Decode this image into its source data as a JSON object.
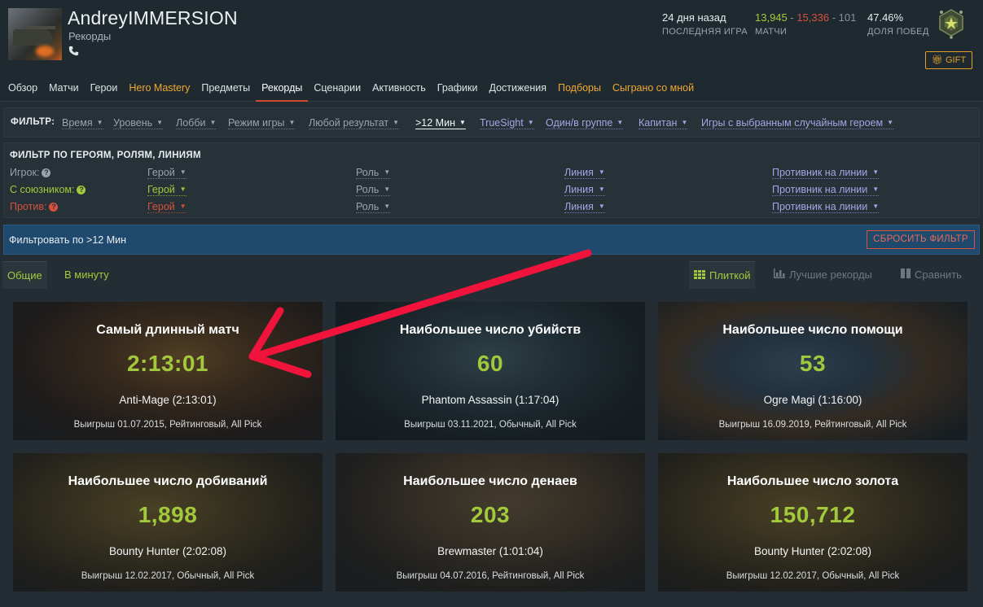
{
  "profile": {
    "name": "AndreyIMMERSION",
    "section": "Рекорды",
    "phone_icon": "phone-icon"
  },
  "stats": {
    "last_game_value": "24 дня назад",
    "last_game_label": "ПОСЛЕДНЯЯ ИГРА",
    "wins": "13,945",
    "losses": "15,336",
    "abandons": "101",
    "matches_label": "МАТЧИ",
    "winrate_value": "47.46%",
    "winrate_label": "ДОЛЯ ПОБЕД",
    "gift_label": "GIFT"
  },
  "tabs": [
    {
      "label": "Обзор"
    },
    {
      "label": "Матчи"
    },
    {
      "label": "Герои"
    },
    {
      "label": "Hero Mastery"
    },
    {
      "label": "Предметы"
    },
    {
      "label": "Рекорды"
    },
    {
      "label": "Сценарии"
    },
    {
      "label": "Активность"
    },
    {
      "label": "Графики"
    },
    {
      "label": "Достижения"
    },
    {
      "label": "Подборы"
    },
    {
      "label": "Сыграно со мной"
    }
  ],
  "filter": {
    "label": "ФИЛЬТР:",
    "items": [
      "Время",
      "Уровень",
      "Лобби",
      "Режим игры",
      "Любой результат",
      ">12 Мин",
      "TrueSight",
      "Один/в группе",
      "Капитан",
      "Игры с выбранным случайным героем"
    ]
  },
  "hero_filter": {
    "title": "ФИЛЬТР ПО ГЕРОЯМ, РОЛЯМ, ЛИНИЯМ",
    "rows": [
      {
        "label": "Игрок:",
        "hero": "Герой",
        "role": "Роль",
        "lane": "Линия",
        "opponent": "Противник на линии"
      },
      {
        "label": "С союзником:",
        "hero": "Герой",
        "role": "Роль",
        "lane": "Линия",
        "opponent": "Противник на линии"
      },
      {
        "label": "Против:",
        "hero": "Герой",
        "role": "Роль",
        "lane": "Линия",
        "opponent": "Противник на линии"
      }
    ],
    "help_glyph": "?"
  },
  "applied": {
    "text": "Фильтровать по >12 Мин",
    "reset_label": "СБРОСИТЬ ФИЛЬТР"
  },
  "subtabs": {
    "general": "Общие",
    "per_minute": "В минуту",
    "tiles": "Плиткой",
    "best_records": "Лучшие рекорды",
    "compare": "Сравнить"
  },
  "cards": [
    {
      "title": "Самый длинный матч",
      "value": "2:13:01",
      "hero": "Anti-Mage (2:13:01)",
      "meta": "Выигрыш 01.07.2015, Рейтинговый, All Pick",
      "tint": "#8a5a2a"
    },
    {
      "title": "Наибольшее число убийств",
      "value": "60",
      "hero": "Phantom Assassin (1:17:04)",
      "meta": "Выигрыш 03.11.2021, Обычный, All Pick",
      "tint": "#3d5a66"
    },
    {
      "title": "Наибольшее число помощи",
      "value": "53",
      "hero": "Ogre Magi (1:16:00)",
      "meta": "Выигрыш 16.09.2019, Рейтинговый, All Pick",
      "tint": "#3f5f7a"
    },
    {
      "title": "Наибольшее число добиваний",
      "value": "1,898",
      "hero": "Bounty Hunter (2:02:08)",
      "meta": "Выигрыш 12.02.2017, Обычный, All Pick",
      "tint": "#7a6428"
    },
    {
      "title": "Наибольшее число денаев",
      "value": "203",
      "hero": "Brewmaster (1:01:04)",
      "meta": "Выигрыш 04.07.2016, Рейтинговый, All Pick",
      "tint": "#6e5a3a"
    },
    {
      "title": "Наибольшее число золота",
      "value": "150,712",
      "hero": "Bounty Hunter (2:02:08)",
      "meta": "Выигрыш 12.02.2017, Обычный, All Pick",
      "tint": "#7a6428"
    }
  ],
  "colors": {
    "accent_green": "#a2c93b",
    "loss_red": "#d9503d",
    "gold": "#e2a02a",
    "filter_purple": "#a9a3e6",
    "applied_blue": "#1f4a6e",
    "annotation_arrow": "#f0143c"
  }
}
